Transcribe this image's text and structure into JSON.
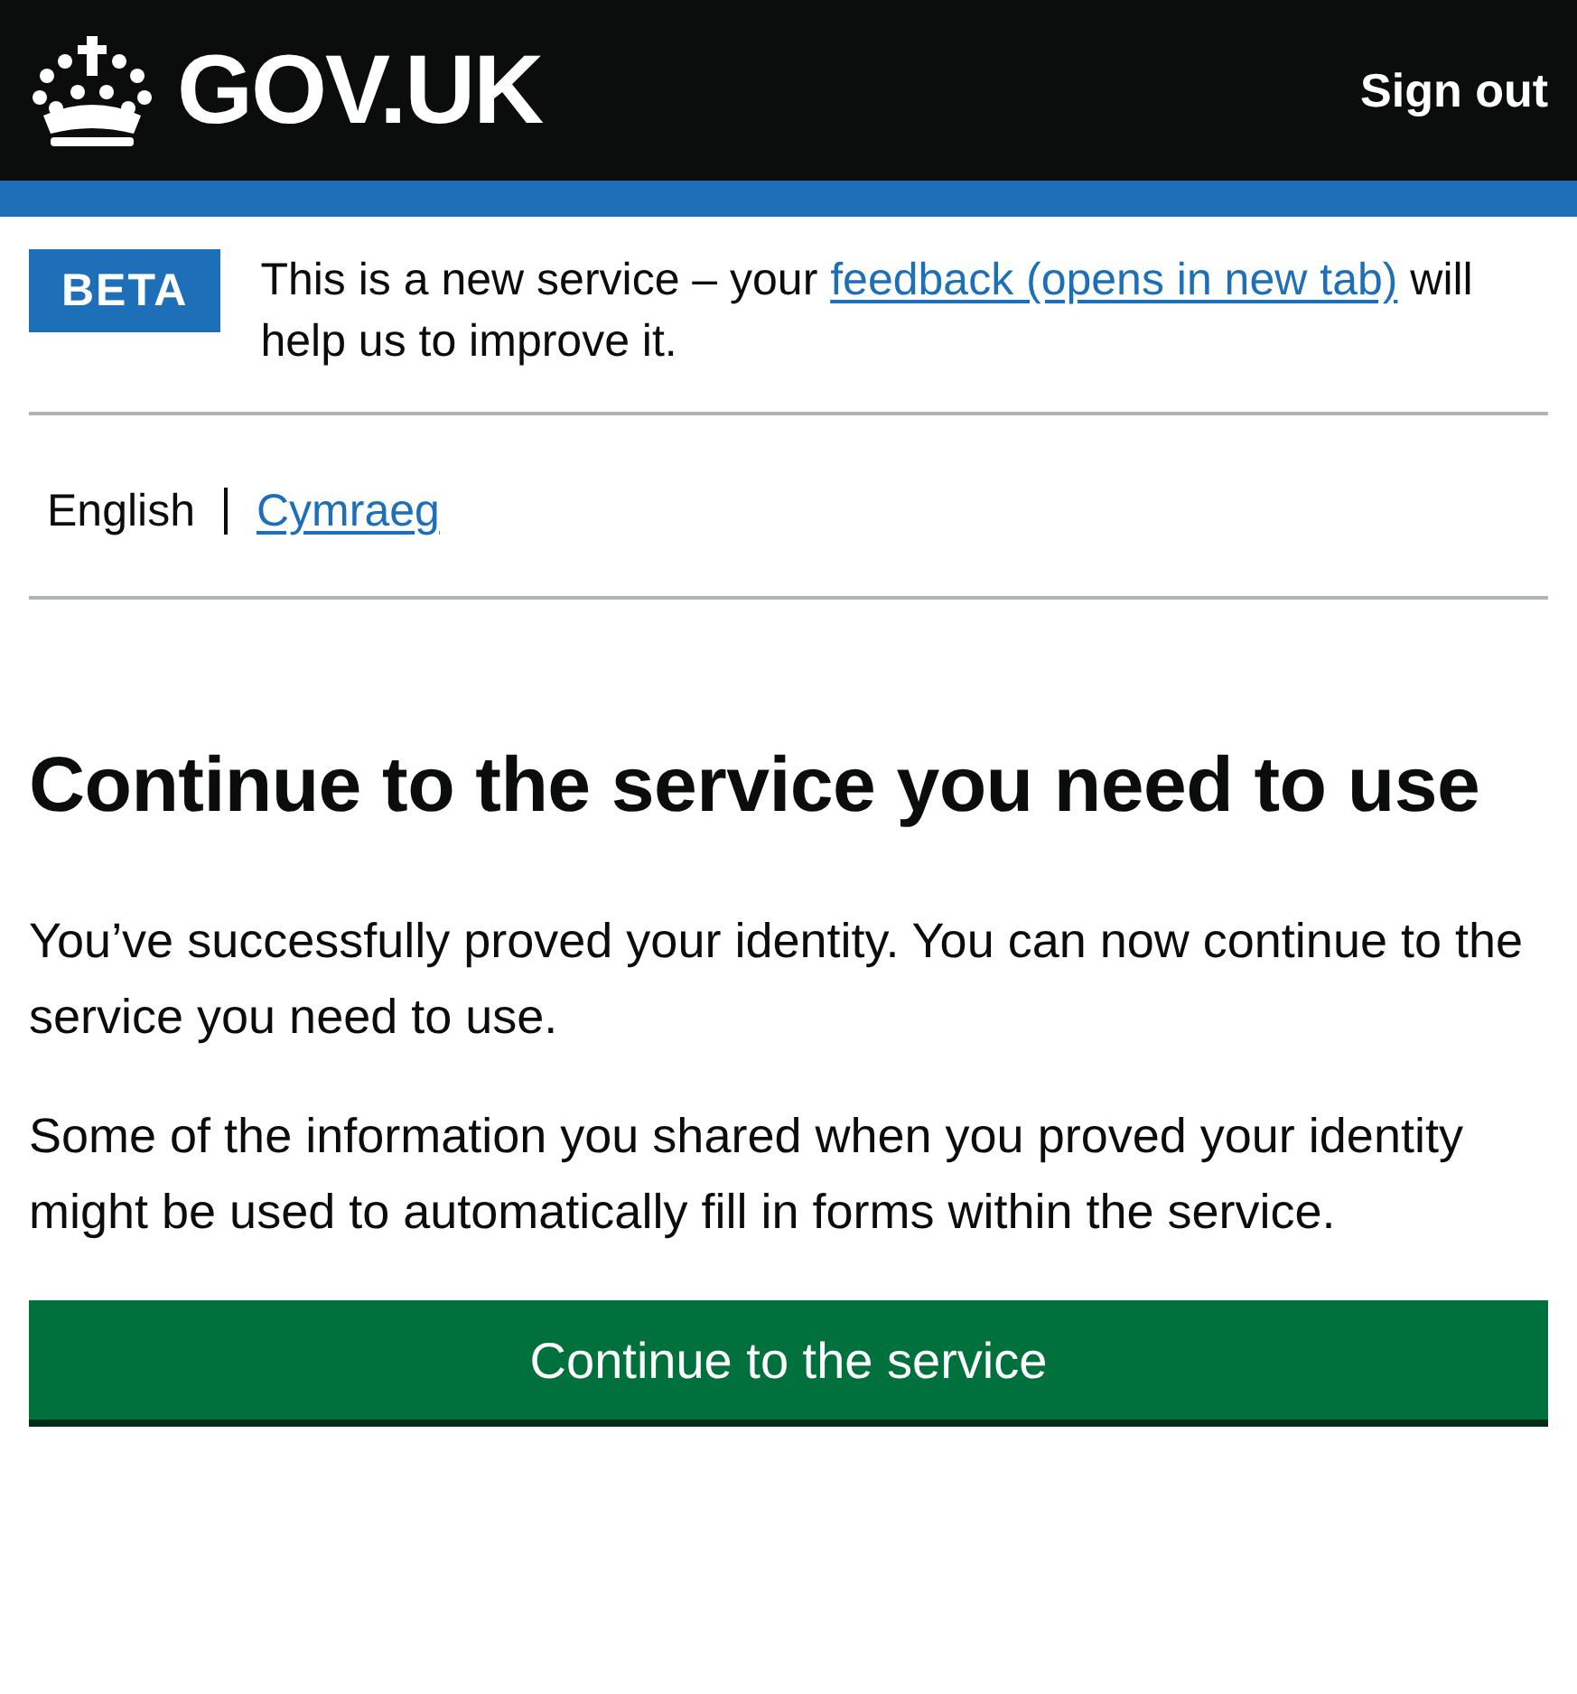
{
  "header": {
    "logo": "GOV.UK",
    "sign_out": "Sign out"
  },
  "phase_banner": {
    "tag": "BETA",
    "text_before": "This is a new service – your ",
    "link": "feedback (opens in new tab)",
    "text_after": " will help us to improve it."
  },
  "languages": [
    {
      "label": "English",
      "selected": true
    },
    {
      "label": "Cymraeg",
      "selected": false
    }
  ],
  "heading": "Continue to the service you need to use",
  "paragraphs": [
    "You’ve successfully proved your identity. You can now continue to the service you need to use.",
    "Some of the information you shared when you proved your identity might be used to automatically fill in forms within the service."
  ],
  "button": "Continue to the service"
}
